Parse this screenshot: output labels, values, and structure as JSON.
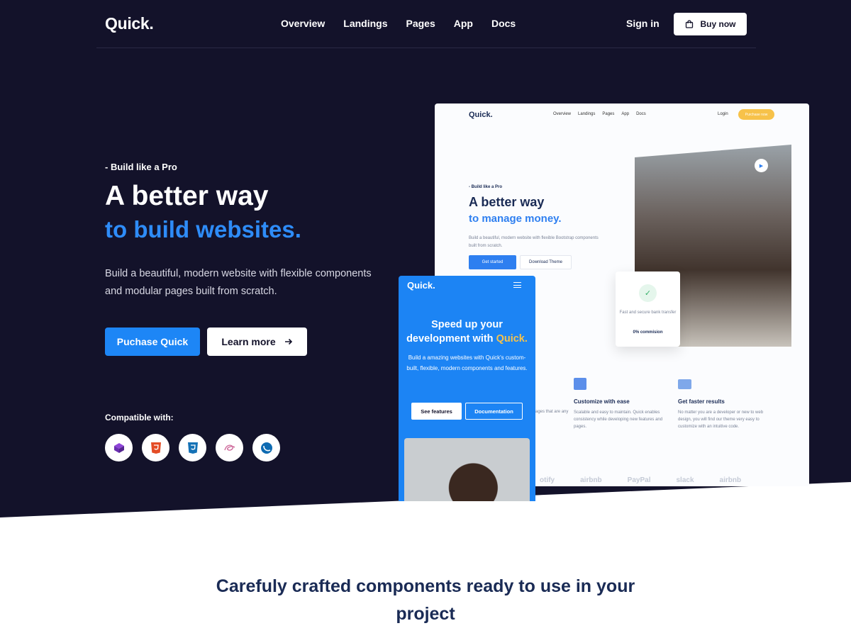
{
  "brand": {
    "logo": "Quick."
  },
  "nav": {
    "links": [
      "Overview",
      "Landings",
      "Pages",
      "App",
      "Docs"
    ],
    "signin": "Sign in",
    "buy": "Buy now"
  },
  "hero": {
    "eyebrow": "- Build like a Pro",
    "title_line1": "A better way",
    "title_line2": "to build websites.",
    "lead": "Build a beautiful, modern website with flexible components and modular pages built from scratch.",
    "primary_button": "Puchase Quick",
    "secondary_button": "Learn more",
    "compatible_label": "Compatible with:",
    "tech_icons": [
      "bootstrap-icon",
      "html5-icon",
      "css3-icon",
      "sass-icon",
      "jquery-icon"
    ]
  },
  "desktop_mock": {
    "logo": "Quick.",
    "nav": [
      "Overview",
      "Landings",
      "Pages",
      "App",
      "Docs"
    ],
    "login": "Login",
    "purchase": "Purchase now",
    "eyebrow": "- Build like a Pro",
    "title1": "A better way",
    "title2": "to manage money.",
    "lead": "Build a beautiful, modern website with flexible Bootstrap components built from scratch.",
    "btn_start": "Get started",
    "btn_download": "Download Theme",
    "card_text": "Fast and secure bank transfer",
    "card_pct": "0% commision",
    "partial_text": "ages that are any",
    "features": [
      {
        "title": "Customize with ease",
        "text": "Scalable and easy to maintain. Quick enables consistency while developing new features and pages."
      },
      {
        "title": "Get faster results",
        "text": "No matter you are a developer or new to web design, you will find our theme very easy to customize with an intuitive code."
      }
    ],
    "logos": [
      "otify",
      "airbnb",
      "PayPal",
      "slack",
      "airbnb"
    ]
  },
  "mobile_mock": {
    "logo": "Quick.",
    "title_pre": "Speed up your development with ",
    "title_highlight": "Quick.",
    "text": "Build a amazing websites with Quick's custom-built, flexible, modern components and features.",
    "btn_features": "See features",
    "btn_docs": "Documentation"
  },
  "section": {
    "title": "Carefuly crafted components ready to use in your project"
  },
  "colors": {
    "navy": "#13122a",
    "accent": "#1d86f6",
    "yellow": "#f7c24a"
  }
}
